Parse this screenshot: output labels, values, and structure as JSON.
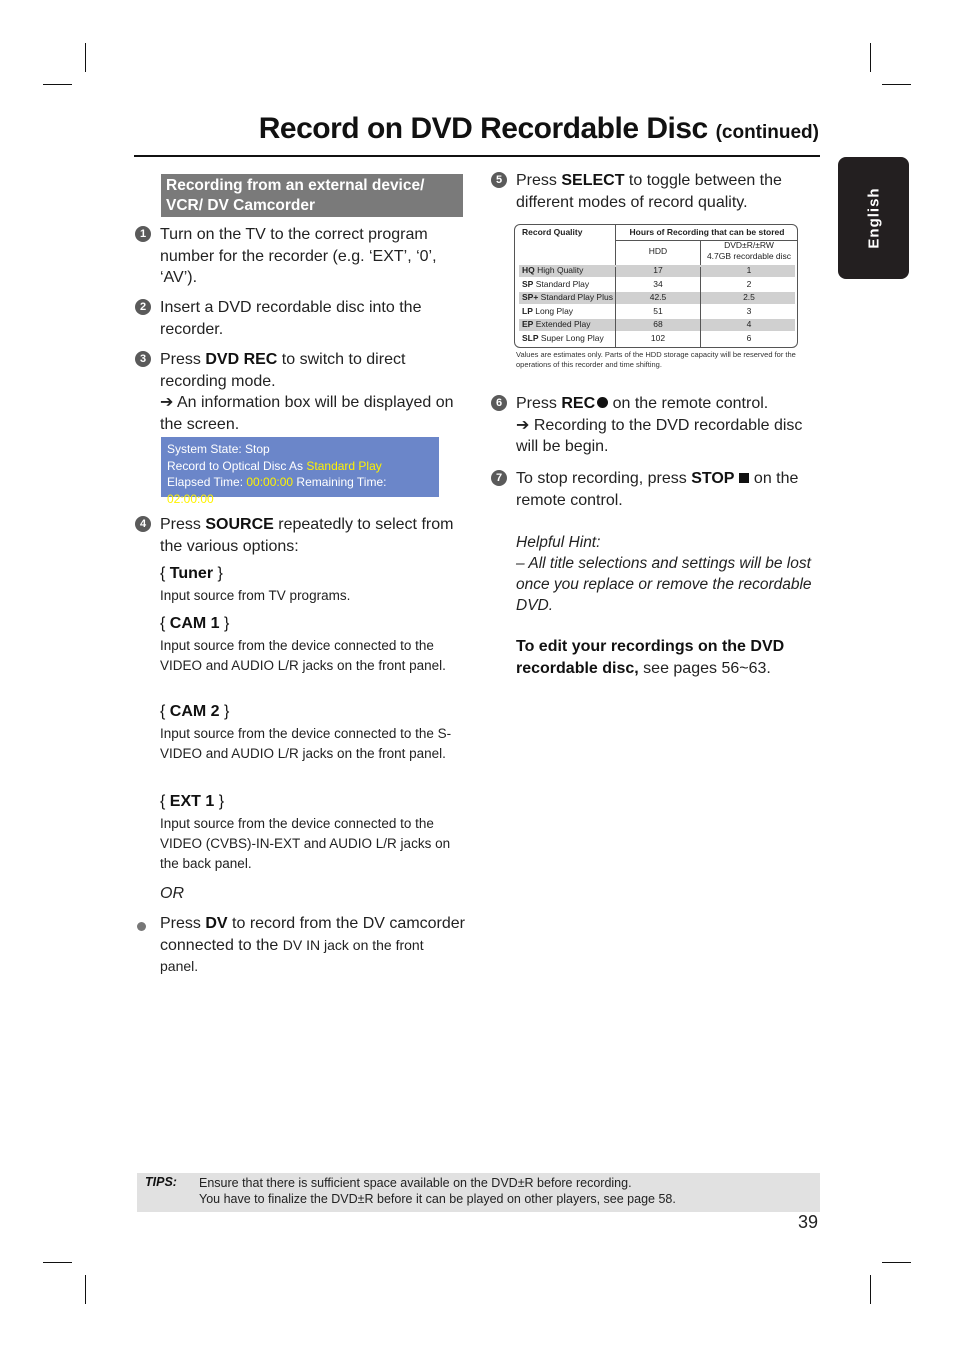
{
  "header": {
    "title": "Record on DVD Recordable Disc",
    "continued": "(continued)"
  },
  "language_tab": "English",
  "section_heading": "Recording from an external device/ VCR/ DV Camcorder",
  "steps": [
    {
      "num": "1",
      "text": "Turn on the TV to the correct program number for the recorder (e.g. ‘EXT’, ‘0’, ‘AV’)."
    },
    {
      "num": "2",
      "text": "Insert a DVD recordable disc into the recorder."
    },
    {
      "num": "3",
      "pre": "Press ",
      "key": "DVD REC",
      "post": " to switch to direct recording mode.",
      "result": "➔ An information box will be displayed on the screen."
    },
    {
      "num": "4",
      "pre": "Press ",
      "key": "SOURCE",
      "post": " repeatedly to select from the various options:"
    },
    {
      "num": "5",
      "pre": "Press ",
      "key": "SELECT",
      "post": " to toggle between the different modes of record quality."
    },
    {
      "num": "6",
      "pre": "Press ",
      "key": "REC",
      "post": " on the remote control.",
      "result": "➔ Recording to the DVD recordable disc will be begin."
    },
    {
      "num": "7",
      "pre": "To stop recording, press ",
      "key": "STOP",
      "post": "  on the remote control."
    }
  ],
  "info_box": {
    "line1": "System State: Stop",
    "line2_label": "Record to Optical Disc As ",
    "line2_value": "Standard Play",
    "elapsed_label": "Elapsed Time:  ",
    "elapsed_value": "00:00:00",
    "remaining_label": " Remaining Time: ",
    "remaining_value": "02:00:00",
    "bg_color": "#6b86c9",
    "highlight_color": "#fff200"
  },
  "source_options": [
    {
      "name": "Tuner",
      "desc": "Input source from TV programs."
    },
    {
      "name": "CAM 1",
      "desc": "Input source from the device connected to the VIDEO and AUDIO L/R jacks on the front panel."
    },
    {
      "name": "CAM 2",
      "desc": "Input source from the device connected to the S-VIDEO and AUDIO L/R jacks on the front panel."
    },
    {
      "name": "EXT 1",
      "desc": "Input source from the device connected to the VIDEO (CVBS)-IN-EXT and AUDIO L/R jacks on the back panel."
    }
  ],
  "or_text": "OR",
  "dv_bullet": {
    "pre": "Press ",
    "key": "DV",
    "post": " to record from the DV camcorder connected to the ",
    "tail": "DV IN jack on the front panel."
  },
  "quality_table": {
    "headers": {
      "quality": "Record Quality",
      "hours": "Hours of Recording that can be stored",
      "hdd": "HDD",
      "dvd_line1": "DVD±R/±RW",
      "dvd_line2": "4.7GB recordable disc"
    },
    "rows": [
      {
        "code": "HQ",
        "name": "High Quality",
        "hdd": "17",
        "dvd": "1"
      },
      {
        "code": "SP",
        "name": "Standard Play",
        "hdd": "34",
        "dvd": "2"
      },
      {
        "code": "SP+",
        "name": "Standard Play Plus",
        "hdd": "42.5",
        "dvd": "2.5"
      },
      {
        "code": "LP",
        "name": "Long Play",
        "hdd": "51",
        "dvd": "3"
      },
      {
        "code": "EP",
        "name": "Extended Play",
        "hdd": "68",
        "dvd": "4"
      },
      {
        "code": "SLP",
        "name": "Super Long Play",
        "hdd": "102",
        "dvd": "6"
      }
    ],
    "note": "Values are estimates only. Parts of the HDD storage capacity will be reserved for the operations of this recorder and time shifting."
  },
  "hint": {
    "title": "Helpful Hint:",
    "text": "– All title selections and settings will be lost once you replace or remove the recordable DVD."
  },
  "edit_ref": {
    "bold": "To edit your recordings on the DVD recordable disc,",
    "rest": " see pages 56~63."
  },
  "tips": {
    "label": "TIPS:",
    "line1": "Ensure that there is sufficient space available on the DVD±R before recording.",
    "line2": "You have to finalize the DVD±R before it can be played on other players, see page 58."
  },
  "page_number": "39"
}
